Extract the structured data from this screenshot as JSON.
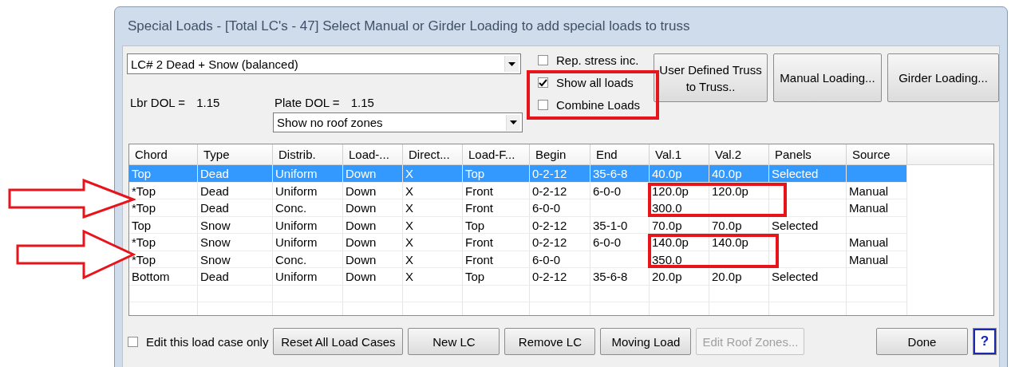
{
  "window": {
    "title": "Special Loads - [Total LC's -  47] Select Manual or Girder Loading to add special loads to truss"
  },
  "load_case": {
    "value": "LC# 2 Dead + Snow (balanced)"
  },
  "options": [
    {
      "label": "Rep. stress inc.",
      "checked": false
    },
    {
      "label": "Show all loads",
      "checked": true
    },
    {
      "label": "Combine Loads",
      "checked": false
    }
  ],
  "top_buttons": [
    {
      "label": "User Defined Truss to Truss.."
    },
    {
      "label": "Manual Loading..."
    },
    {
      "label": "Girder Loading..."
    }
  ],
  "lbr_dol": {
    "label": "Lbr DOL =",
    "value": "1.15"
  },
  "plate_dol": {
    "label": "Plate DOL =",
    "value": "1.15"
  },
  "roof_zones": {
    "value": "Show no roof zones"
  },
  "table": {
    "columns": [
      "Chord",
      "Type",
      "Distrib.",
      "Load-...",
      "Direct...",
      "Load-F...",
      "Begin",
      "End",
      "Val.1",
      "Val.2",
      "Panels",
      "Source"
    ],
    "rows": [
      {
        "selected": true,
        "cells": [
          "Top",
          "Dead",
          "Uniform",
          "Down",
          "X",
          "Top",
          "0-2-12",
          "35-6-8",
          "40.0p",
          "40.0p",
          "Selected",
          ""
        ]
      },
      {
        "selected": false,
        "cells": [
          "*Top",
          "Dead",
          "Uniform",
          "Down",
          "X",
          "Front",
          "0-2-12",
          "6-0-0",
          "120.0p",
          "120.0p",
          "",
          "Manual"
        ]
      },
      {
        "selected": false,
        "cells": [
          "*Top",
          "Dead",
          "Conc.",
          "Down",
          "X",
          "Front",
          "6-0-0",
          "",
          "300.0",
          "",
          "",
          "Manual"
        ]
      },
      {
        "selected": false,
        "cells": [
          "Top",
          "Snow",
          "Uniform",
          "Down",
          "X",
          "Top",
          "0-2-12",
          "35-1-0",
          "70.0p",
          "70.0p",
          "Selected",
          ""
        ]
      },
      {
        "selected": false,
        "cells": [
          "*Top",
          "Snow",
          "Uniform",
          "Down",
          "X",
          "Front",
          "0-2-12",
          "6-0-0",
          "140.0p",
          "140.0p",
          "",
          "Manual"
        ]
      },
      {
        "selected": false,
        "cells": [
          "*Top",
          "Snow",
          "Conc.",
          "Down",
          "X",
          "Front",
          "6-0-0",
          "",
          "350.0",
          "",
          "",
          "Manual"
        ]
      },
      {
        "selected": false,
        "cells": [
          "Bottom",
          "Dead",
          "Uniform",
          "Down",
          "X",
          "Top",
          "0-2-12",
          "35-6-8",
          "20.0p",
          "20.0p",
          "Selected",
          ""
        ]
      }
    ]
  },
  "edit_only": {
    "label": "Edit this load case only",
    "checked": false
  },
  "bottom_buttons": [
    {
      "label": "Reset All Load Cases",
      "disabled": false
    },
    {
      "label": "New LC",
      "disabled": false
    },
    {
      "label": "Remove LC",
      "disabled": false
    },
    {
      "label": "Moving Load",
      "disabled": false
    },
    {
      "label": "Edit Roof Zones...",
      "disabled": true
    }
  ],
  "done": {
    "label": "Done"
  },
  "help": {
    "label": "?"
  }
}
